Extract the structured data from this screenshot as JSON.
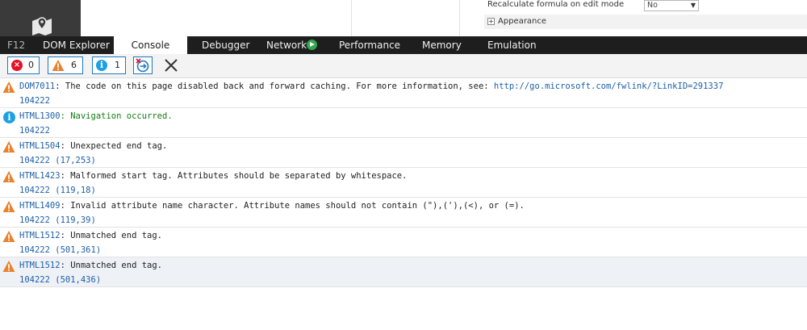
{
  "properties": {
    "recalc_label": "Recalculate formula on edit mode",
    "recalc_value": "No",
    "appearance_label": "Appearance",
    "expander_glyph": "+"
  },
  "devtools": {
    "tabs": [
      {
        "label": "F12"
      },
      {
        "label": "DOM Explorer"
      },
      {
        "label": "Console"
      },
      {
        "label": "Debugger"
      },
      {
        "label": "Network"
      },
      {
        "label": "Performance"
      },
      {
        "label": "Memory"
      },
      {
        "label": "Emulation"
      }
    ],
    "active_tab": "Console"
  },
  "toolbar": {
    "errors_count": "0",
    "warnings_count": "6",
    "info_count": "1",
    "error_glyph": "×",
    "info_glyph": "i",
    "icons": [
      "error-filter-icon",
      "warning-filter-icon",
      "info-filter-icon",
      "target-frame-icon",
      "clear-console-icon"
    ]
  },
  "messages": [
    {
      "type": "warning",
      "code": "DOM7011",
      "text": ": The code on this page disabled back and forward caching. For more information, see: ",
      "link": "http://go.microsoft.com/fwlink/?LinkID=291337",
      "source": "104222"
    },
    {
      "type": "info",
      "code": "HTML1300",
      "text": ": Navigation occurred.",
      "link": "",
      "source": "104222"
    },
    {
      "type": "warning",
      "code": "HTML1504",
      "text": ": Unexpected end tag.",
      "link": "",
      "source": "104222 (17,253)"
    },
    {
      "type": "warning",
      "code": "HTML1423",
      "text": ": Malformed start tag. Attributes should be separated by whitespace.",
      "link": "",
      "source": "104222 (119,18)"
    },
    {
      "type": "warning",
      "code": "HTML1409",
      "text": ": Invalid attribute name character. Attribute names should not contain (\"),('),(<), or (=).",
      "link": "",
      "source": "104222 (119,39)"
    },
    {
      "type": "warning",
      "code": "HTML1512",
      "text": ": Unmatched end tag.",
      "link": "",
      "source": "104222 (501,361)"
    },
    {
      "type": "warning",
      "code": "HTML1512",
      "text": ": Unmatched end tag.",
      "link": "",
      "source": "104222 (501,436)"
    }
  ],
  "colors": {
    "tabbar_bg": "#1e1e1e",
    "warning": "#e8822c",
    "error": "#e81123",
    "info": "#1ba1e2",
    "link": "#1e5fa8",
    "info_text": "#107c10",
    "network_icon": "#2fa84f"
  }
}
